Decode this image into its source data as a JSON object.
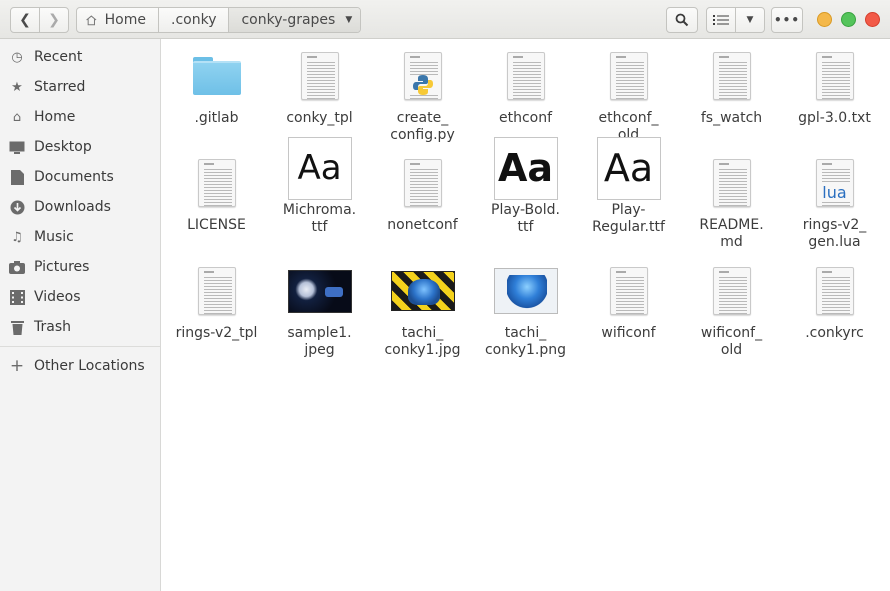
{
  "header": {
    "breadcrumbs": [
      "Home",
      ".conky",
      "conky-grapes"
    ]
  },
  "sidebar": {
    "items": [
      {
        "label": "Recent",
        "icon": "clock-icon"
      },
      {
        "label": "Starred",
        "icon": "star-icon"
      },
      {
        "label": "Home",
        "icon": "home-icon"
      },
      {
        "label": "Desktop",
        "icon": "desktop-icon"
      },
      {
        "label": "Documents",
        "icon": "documents-icon"
      },
      {
        "label": "Downloads",
        "icon": "download-icon"
      },
      {
        "label": "Music",
        "icon": "music-icon"
      },
      {
        "label": "Pictures",
        "icon": "camera-icon"
      },
      {
        "label": "Videos",
        "icon": "film-icon"
      },
      {
        "label": "Trash",
        "icon": "trash-icon"
      }
    ],
    "other_locations": "Other Locations"
  },
  "files": [
    {
      "name": ".gitlab",
      "kind": "folder"
    },
    {
      "name": "conky_tpl",
      "kind": "text"
    },
    {
      "name": "create_\nconfig.py",
      "kind": "python"
    },
    {
      "name": "ethconf",
      "kind": "text"
    },
    {
      "name": "ethconf_\nold",
      "kind": "text"
    },
    {
      "name": "fs_watch",
      "kind": "text"
    },
    {
      "name": "gpl-3.0.txt",
      "kind": "text"
    },
    {
      "name": "LICENSE",
      "kind": "text"
    },
    {
      "name": "Michroma.\nttf",
      "kind": "font",
      "preview": "Aa"
    },
    {
      "name": "nonetconf",
      "kind": "text"
    },
    {
      "name": "Play-Bold.\nttf",
      "kind": "font-bold",
      "preview": "Aa"
    },
    {
      "name": "Play-\nRegular.ttf",
      "kind": "font",
      "preview": "Aa"
    },
    {
      "name": "README.\nmd",
      "kind": "text"
    },
    {
      "name": "rings-v2_\ngen.lua",
      "kind": "lua",
      "badge": "lua"
    },
    {
      "name": "rings-v2_tpl",
      "kind": "text"
    },
    {
      "name": "sample1.\njpeg",
      "kind": "img-space"
    },
    {
      "name": "tachi_\nconky1.jpg",
      "kind": "img-tachi1"
    },
    {
      "name": "tachi_\nconky1.png",
      "kind": "img-tachi2"
    },
    {
      "name": "wificonf",
      "kind": "text"
    },
    {
      "name": "wificonf_\nold",
      "kind": "text"
    },
    {
      "name": ".conkyrc",
      "kind": "text"
    }
  ],
  "colors": {
    "folder": "#6fc0e7",
    "close": "#f25a48",
    "maximize": "#54c45b",
    "minimize": "#f4b84a"
  }
}
